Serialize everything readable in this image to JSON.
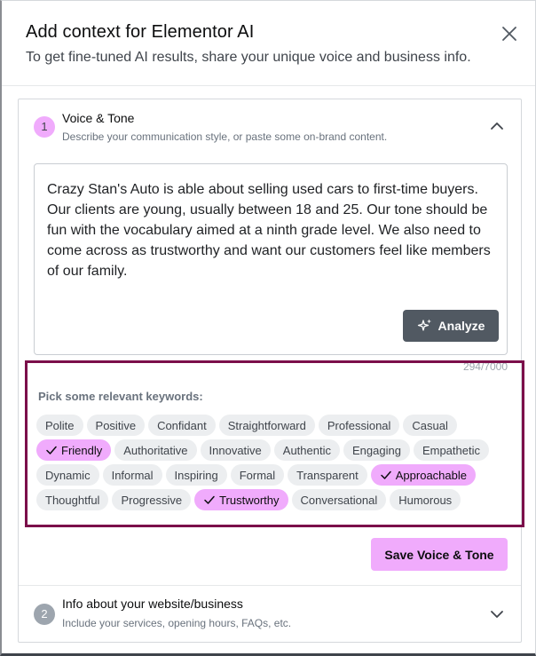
{
  "header": {
    "title": "Add context for Elementor AI",
    "subtitle": "To get fine-tuned AI results, share your unique voice and business info.",
    "close_icon": "close-icon"
  },
  "sections": [
    {
      "step": "1",
      "title": "Voice & Tone",
      "description": "Describe your communication style, or paste some on-brand content.",
      "expanded": true,
      "chevron_icon": "chevron-up-icon",
      "textarea_value": "Crazy Stan's Auto is able about selling used cars to first-time buyers. Our clients are young, usually between 18 and 25. Our tone should be fun with the vocabulary aimed at a ninth grade level. We also need to come across as trustworthy and want our customers feel like members of our family.",
      "analyze_label": "Analyze",
      "analyze_icon": "sparkles-icon",
      "char_count": "294/7000",
      "keywords_label": "Pick some relevant keywords:",
      "keyword_rows": [
        [
          {
            "label": "Polite",
            "selected": false
          },
          {
            "label": "Positive",
            "selected": false
          },
          {
            "label": "Confidant",
            "selected": false
          },
          {
            "label": "Straightforward",
            "selected": false
          },
          {
            "label": "Professional",
            "selected": false
          },
          {
            "label": "Casual",
            "selected": false
          }
        ],
        [
          {
            "label": "Friendly",
            "selected": true
          },
          {
            "label": "Authoritative",
            "selected": false
          },
          {
            "label": "Innovative",
            "selected": false
          },
          {
            "label": "Authentic",
            "selected": false
          },
          {
            "label": "Engaging",
            "selected": false
          },
          {
            "label": "Empathetic",
            "selected": false
          }
        ],
        [
          {
            "label": "Dynamic",
            "selected": false
          },
          {
            "label": "Informal",
            "selected": false
          },
          {
            "label": "Inspiring",
            "selected": false
          },
          {
            "label": "Formal",
            "selected": false
          },
          {
            "label": "Transparent",
            "selected": false
          },
          {
            "label": "Approachable",
            "selected": true
          }
        ],
        [
          {
            "label": "Thoughtful",
            "selected": false
          },
          {
            "label": "Progressive",
            "selected": false
          },
          {
            "label": "Trustworthy",
            "selected": true
          },
          {
            "label": "Conversational",
            "selected": false
          },
          {
            "label": "Humorous",
            "selected": false
          }
        ]
      ],
      "save_label": "Save Voice & Tone"
    },
    {
      "step": "2",
      "title": "Info about your website/business",
      "description": "Include your services, opening hours, FAQs, etc.",
      "expanded": false,
      "chevron_icon": "chevron-down-icon"
    }
  ],
  "colors": {
    "accent_pink": "#f0abfc",
    "highlight_border": "#7b0f4a",
    "analyze_button": "#515962"
  }
}
